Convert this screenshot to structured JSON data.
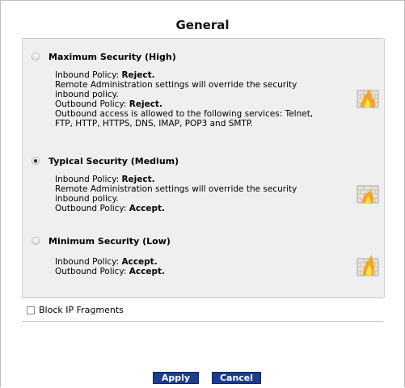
{
  "page": {
    "title": "General"
  },
  "options": [
    {
      "label": "Maximum Security (High)",
      "checked": false,
      "lines": [
        [
          "Inbound Policy: ",
          "Reject."
        ],
        [
          "Remote Administration settings will override the security",
          ""
        ],
        [
          "inbound policy.",
          ""
        ],
        [
          "Outbound Policy: ",
          "Reject."
        ],
        [
          "Outbound access is allowed to the following services: Telnet,",
          ""
        ],
        [
          "FTP, HTTP, HTTPS, DNS, IMAP, POP3 and SMTP.",
          ""
        ]
      ],
      "icon": "firewall-brick-flame-icon"
    },
    {
      "label": "Typical Security (Medium)",
      "checked": true,
      "lines": [
        [
          "Inbound Policy: ",
          "Reject."
        ],
        [
          "Remote Administration settings will override the security",
          ""
        ],
        [
          "inbound policy.",
          ""
        ],
        [
          "Outbound Policy: ",
          "Accept."
        ]
      ],
      "icon": "firewall-brick-flame-icon"
    },
    {
      "label": "Minimum Security (Low)",
      "checked": false,
      "lines": [
        [
          "Inbound Policy: ",
          "Accept."
        ],
        [
          "Outbound Policy: ",
          "Accept."
        ]
      ],
      "icon": "firewall-brick-flame-icon"
    }
  ],
  "block_ip_fragments": {
    "label": "Block IP Fragments",
    "checked": false
  },
  "buttons": {
    "apply": "Apply",
    "cancel": "Cancel"
  },
  "colors": {
    "button_bg": "#1c3d8f",
    "panel_bg": "#efefef"
  }
}
